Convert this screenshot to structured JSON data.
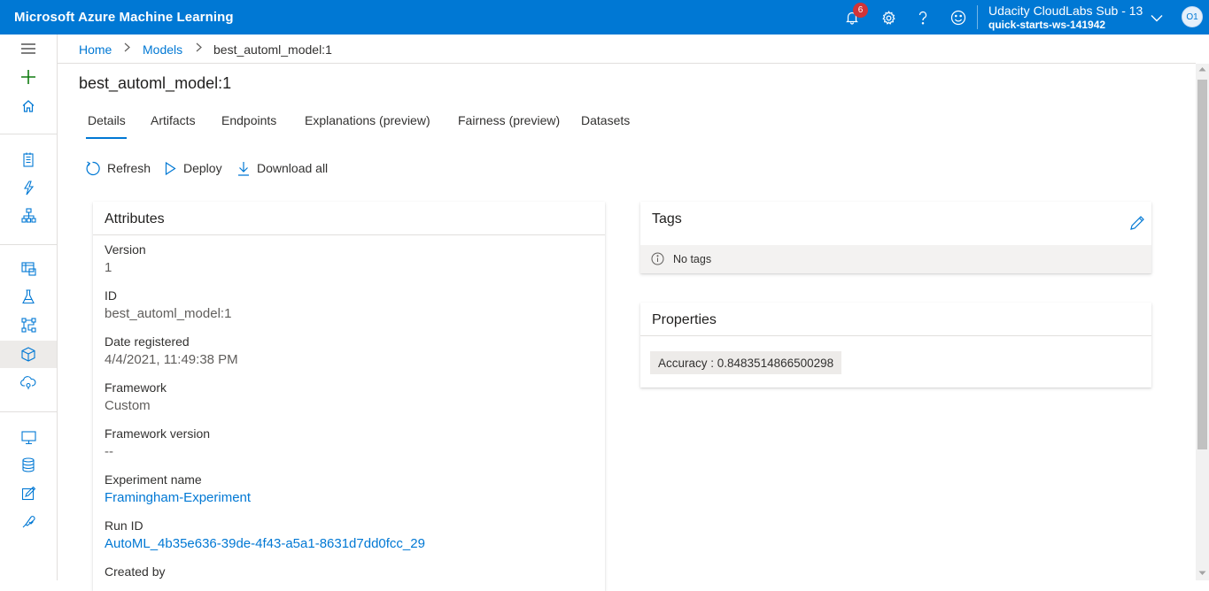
{
  "app": {
    "title": "Microsoft Azure Machine Learning"
  },
  "topbar": {
    "notifications_count": "6",
    "account_name": "Udacity CloudLabs Sub - 13",
    "workspace": "quick-starts-ws-141942",
    "avatar_initials": "O1"
  },
  "breadcrumb": [
    "Home",
    "Models",
    "best_automl_model:1"
  ],
  "page": {
    "title": "best_automl_model:1",
    "tabs": [
      "Details",
      "Artifacts",
      "Endpoints",
      "Explanations (preview)",
      "Fairness (preview)",
      "Datasets"
    ],
    "active_tab": "Details",
    "commands": {
      "refresh": "Refresh",
      "deploy": "Deploy",
      "download": "Download all"
    }
  },
  "attributes": {
    "title": "Attributes",
    "items": [
      {
        "label": "Version",
        "value": "1"
      },
      {
        "label": "ID",
        "value": "best_automl_model:1"
      },
      {
        "label": "Date registered",
        "value": "4/4/2021, 11:49:38 PM"
      },
      {
        "label": "Framework",
        "value": "Custom"
      },
      {
        "label": "Framework version",
        "value": "--"
      },
      {
        "label": "Experiment name",
        "value": "Framingham-Experiment"
      },
      {
        "label": "Run ID",
        "value": "AutoML_4b35e636-39de-4f43-a5a1-8631d7dd0fcc_29"
      },
      {
        "label": "Created by",
        "value": ""
      }
    ]
  },
  "tags": {
    "title": "Tags",
    "empty_text": "No tags"
  },
  "properties": {
    "title": "Properties",
    "items": [
      "Accuracy : 0.8483514866500298"
    ]
  },
  "colors": {
    "accent": "#0078d4",
    "badge": "#d13438",
    "add_green": "#107c10"
  }
}
